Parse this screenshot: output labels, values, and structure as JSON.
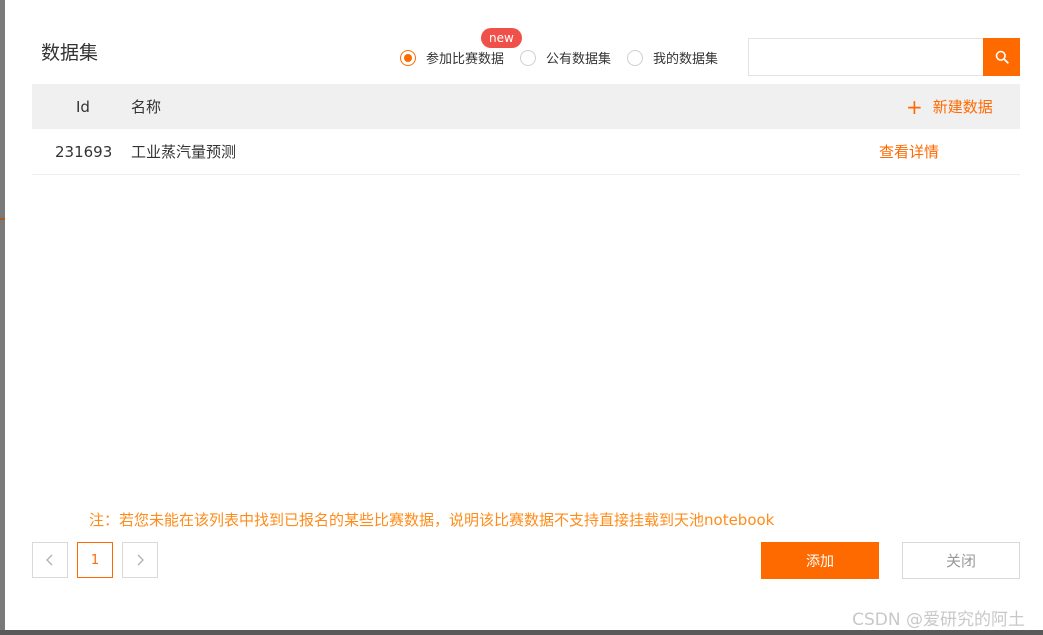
{
  "dialog": {
    "title": "数据集"
  },
  "filters": {
    "options": [
      {
        "label": "参加比赛数据",
        "checked": true
      },
      {
        "label": "公有数据集",
        "checked": false
      },
      {
        "label": "我的数据集",
        "checked": false
      }
    ],
    "new_badge": "new"
  },
  "search": {
    "value": "",
    "placeholder": "",
    "icon": "search-icon"
  },
  "table": {
    "headers": {
      "id": "Id",
      "name": "名称"
    },
    "new_data_label": "新建数据",
    "rows": [
      {
        "id": "231693",
        "name": "工业蒸汽量预测",
        "action": "查看详情"
      }
    ]
  },
  "note": "注：若您未能在该列表中找到已报名的某些比赛数据，说明该比赛数据不支持直接挂载到天池notebook",
  "pagination": {
    "prev_icon": "chevron-left-icon",
    "current_page": "1",
    "next_icon": "chevron-right-icon"
  },
  "buttons": {
    "add": "添加",
    "close": "关闭"
  },
  "watermark": "CSDN @爱研究的阿土",
  "colors": {
    "accent": "#ff6a00",
    "badge": "#f0504a",
    "note": "#ff8c1a"
  }
}
